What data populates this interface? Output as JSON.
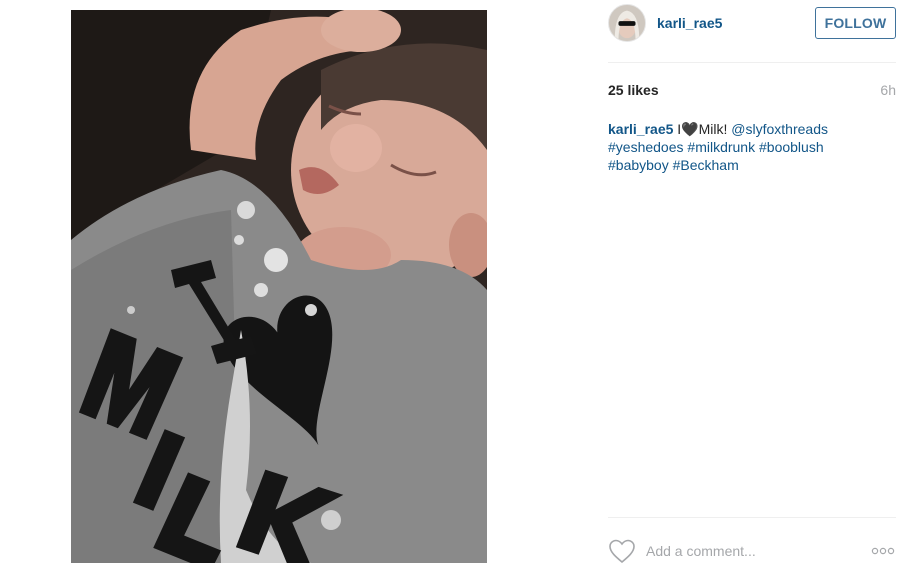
{
  "post": {
    "photo_description_icon": "baby-photo",
    "author": {
      "username": "karli_rae5",
      "avatar_icon": "user-avatar"
    },
    "follow_label": "FOLLOW",
    "likes_text": "25 likes",
    "timestamp": "6h",
    "caption": {
      "username": "karli_rae5",
      "text_before_heart": "I",
      "heart_glyph": "🖤",
      "text_after_heart": "Milk! ",
      "mention": "@slyfoxthreads",
      "hashtags_line1": [
        "#yeshedoes",
        "#milkdrunk",
        "#booblush"
      ],
      "hashtags_line2": [
        "#babyboy",
        "#Beckham"
      ]
    },
    "comment": {
      "placeholder": "Add a comment...",
      "like_icon": "heart-outline-icon",
      "more_icon": "more-options-icon"
    },
    "colors": {
      "link": "#125688",
      "follow": "#3f729b",
      "muted": "#a5a7aa",
      "divider": "#efefef"
    },
    "shirt_print": {
      "line1": "I",
      "line2": "MILK"
    }
  }
}
